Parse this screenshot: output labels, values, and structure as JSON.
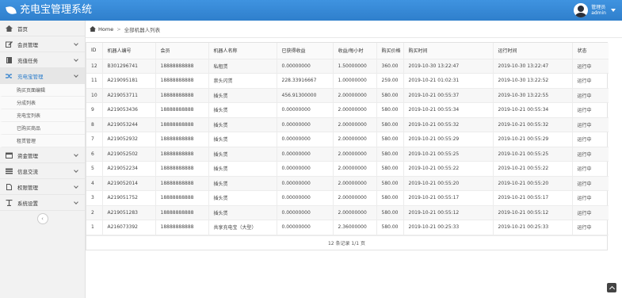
{
  "app": {
    "title": "充电宝管理系统",
    "user_name": "管理员",
    "user_role": "admin"
  },
  "sidebar": {
    "items": [
      {
        "label": "首页",
        "icon": "home-icon"
      },
      {
        "label": "会员管理",
        "icon": "edit-icon"
      },
      {
        "label": "充值任务",
        "icon": "book-icon"
      },
      {
        "label": "充电宝管理",
        "icon": "shuffle-icon",
        "active": true,
        "sub": [
          "购买页面编辑",
          "分成列表",
          "充电宝列表",
          "已购买商品",
          "租赁管理"
        ]
      },
      {
        "label": "资金管理",
        "icon": "calendar-icon"
      },
      {
        "label": "信息交流",
        "icon": "list-icon"
      },
      {
        "label": "权限管理",
        "icon": "file-icon"
      },
      {
        "label": "系统设置",
        "icon": "settings-icon"
      }
    ],
    "collapse_symbol": "‹"
  },
  "breadcrumb": {
    "home": "Home",
    "separator": ">",
    "current": "全部机器人列表"
  },
  "table": {
    "headers": [
      "ID",
      "机器人编号",
      "会员",
      "机器人名称",
      "已获得收益",
      "收益/每小时",
      "购买价格",
      "购买时间",
      "运行时间",
      "状态"
    ],
    "rows": [
      [
        "12",
        "B301296741",
        "18888888888",
        "私租赁",
        "0.00000000",
        "1.50000000",
        "360.00",
        "2019-10-30 13:22:47",
        "2019-10-30 13:22:47",
        "运行中"
      ],
      [
        "11",
        "A219095181",
        "18888888888",
        "崇头闪赁",
        "228.33916667",
        "1.00000000",
        "259.00",
        "2019-10-21 01:02:31",
        "2019-10-30 13:22:52",
        "运行中"
      ],
      [
        "10",
        "A219053711",
        "18888888888",
        "插头赁",
        "456.91300000",
        "2.00000000",
        "580.00",
        "2019-10-21 00:55:37",
        "2019-10-30 13:22:55",
        "运行中"
      ],
      [
        "9",
        "A219053436",
        "18888888888",
        "插头赁",
        "0.00000000",
        "2.00000000",
        "580.00",
        "2019-10-21 00:55:34",
        "2019-10-21 00:55:34",
        "运行中"
      ],
      [
        "8",
        "A219053244",
        "18888888888",
        "插头赁",
        "0.00000000",
        "2.00000000",
        "580.00",
        "2019-10-21 00:55:32",
        "2019-10-21 00:55:32",
        "运行中"
      ],
      [
        "7",
        "A219052932",
        "18888888888",
        "插头赁",
        "0.00000000",
        "2.00000000",
        "580.00",
        "2019-10-21 00:55:29",
        "2019-10-21 00:55:29",
        "运行中"
      ],
      [
        "6",
        "A219052502",
        "18888888888",
        "插头赁",
        "0.00000000",
        "2.00000000",
        "580.00",
        "2019-10-21 00:55:25",
        "2019-10-21 00:55:25",
        "运行中"
      ],
      [
        "5",
        "A219052234",
        "18888888888",
        "插头赁",
        "0.00000000",
        "2.00000000",
        "580.00",
        "2019-10-21 00:55:22",
        "2019-10-21 00:55:22",
        "运行中"
      ],
      [
        "4",
        "A219052014",
        "18888888888",
        "插头赁",
        "0.00000000",
        "2.00000000",
        "580.00",
        "2019-10-21 00:55:20",
        "2019-10-21 00:55:20",
        "运行中"
      ],
      [
        "3",
        "A219051752",
        "18888888888",
        "插头赁",
        "0.00000000",
        "2.00000000",
        "580.00",
        "2019-10-21 00:55:17",
        "2019-10-21 00:55:17",
        "运行中"
      ],
      [
        "2",
        "A219051283",
        "18888888888",
        "插头赁",
        "0.00000000",
        "2.00000000",
        "580.00",
        "2019-10-21 00:55:12",
        "2019-10-21 00:55:12",
        "运行中"
      ],
      [
        "1",
        "A216073392",
        "18888888888",
        "共享充电宝（大型）",
        "0.00000000",
        "2.36000000",
        "580.00",
        "2019-10-21 00:25:33",
        "2019-10-21 00:25:33",
        "运行中"
      ]
    ],
    "pager": "12 条记录 1/1 页"
  },
  "colors": {
    "topbar": "#2f7fcc",
    "accent": "#2f7fcc"
  }
}
